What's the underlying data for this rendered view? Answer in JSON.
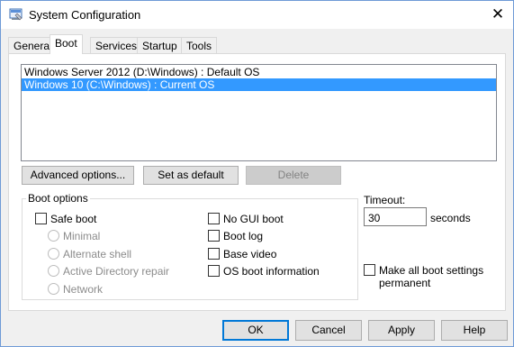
{
  "window": {
    "title": "System Configuration",
    "icon": "msconfig-icon",
    "close_glyph": "✕"
  },
  "tabs": [
    {
      "label": "General",
      "active": false
    },
    {
      "label": "Boot",
      "active": true
    },
    {
      "label": "Services",
      "active": false
    },
    {
      "label": "Startup",
      "active": false
    },
    {
      "label": "Tools",
      "active": false
    }
  ],
  "os_list": [
    {
      "text": "Windows Server 2012 (D:\\Windows) : Default OS",
      "selected": false
    },
    {
      "text": "Windows 10 (C:\\Windows) : Current OS",
      "selected": true
    }
  ],
  "list_buttons": {
    "advanced": "Advanced options...",
    "set_default": "Set as default",
    "delete": "Delete"
  },
  "boot_options": {
    "label": "Boot options",
    "safe_boot": {
      "label": "Safe boot",
      "checked": false
    },
    "minimal": {
      "label": "Minimal",
      "enabled": false
    },
    "alternate_shell": {
      "label": "Alternate shell",
      "enabled": false
    },
    "active_directory_repair": {
      "label": "Active Directory repair",
      "enabled": false
    },
    "network": {
      "label": "Network",
      "enabled": false
    },
    "no_gui_boot": {
      "label": "No GUI boot",
      "checked": false
    },
    "boot_log": {
      "label": "Boot log",
      "checked": false
    },
    "base_video": {
      "label": "Base video",
      "checked": false
    },
    "os_boot_information": {
      "label": "OS boot information",
      "checked": false
    }
  },
  "timeout": {
    "label": "Timeout:",
    "value": "30",
    "unit": "seconds"
  },
  "make_permanent": {
    "line1": "Make all boot settings",
    "line2": "permanent",
    "checked": false
  },
  "dialog_buttons": {
    "ok": "OK",
    "cancel": "Cancel",
    "apply": "Apply",
    "help": "Help"
  },
  "colors": {
    "selection": "#3399ff",
    "window_border": "#6e9ad6",
    "default_button_border": "#0078d7"
  }
}
